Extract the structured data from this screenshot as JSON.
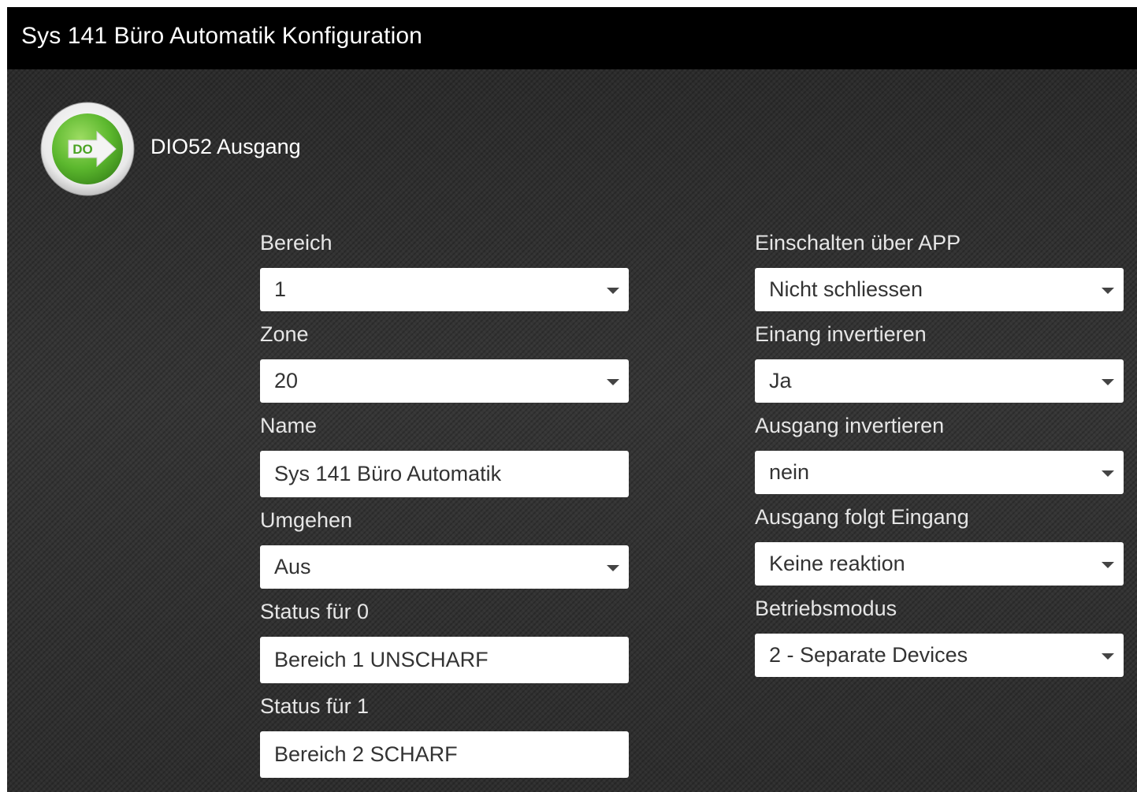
{
  "window": {
    "title": "Sys 141 Büro Automatik Konfiguration"
  },
  "device": {
    "icon_text": "DO",
    "icon": "digital-output-arrow-icon",
    "label": "DIO52 Ausgang"
  },
  "colors": {
    "titlebar": "#000000",
    "background": "#2b2b2b",
    "icon_green": "#5cb82e",
    "field_bg": "#ffffff",
    "label_text": "#e6e6e6"
  },
  "left_fields": [
    {
      "label": "Bereich",
      "type": "select",
      "value": "1"
    },
    {
      "label": "Zone",
      "type": "select",
      "value": "20"
    },
    {
      "label": "Name",
      "type": "text",
      "value": "Sys 141 Büro Automatik"
    },
    {
      "label": "Umgehen",
      "type": "select",
      "value": "Aus"
    },
    {
      "label": "Status für 0",
      "type": "text",
      "value": "Bereich 1 UNSCHARF"
    },
    {
      "label": "Status für 1",
      "type": "text",
      "value": "Bereich 2 SCHARF"
    }
  ],
  "right_fields": [
    {
      "label": "Einschalten über APP",
      "type": "select",
      "value": "Nicht schliessen"
    },
    {
      "label": "Einang invertieren",
      "type": "select",
      "value": "Ja"
    },
    {
      "label": "Ausgang invertieren",
      "type": "select",
      "value": "nein"
    },
    {
      "label": "Ausgang folgt Eingang",
      "type": "select",
      "value": "Keine reaktion"
    },
    {
      "label": "Betriebsmodus",
      "type": "select",
      "value": "2 - Separate Devices"
    }
  ]
}
